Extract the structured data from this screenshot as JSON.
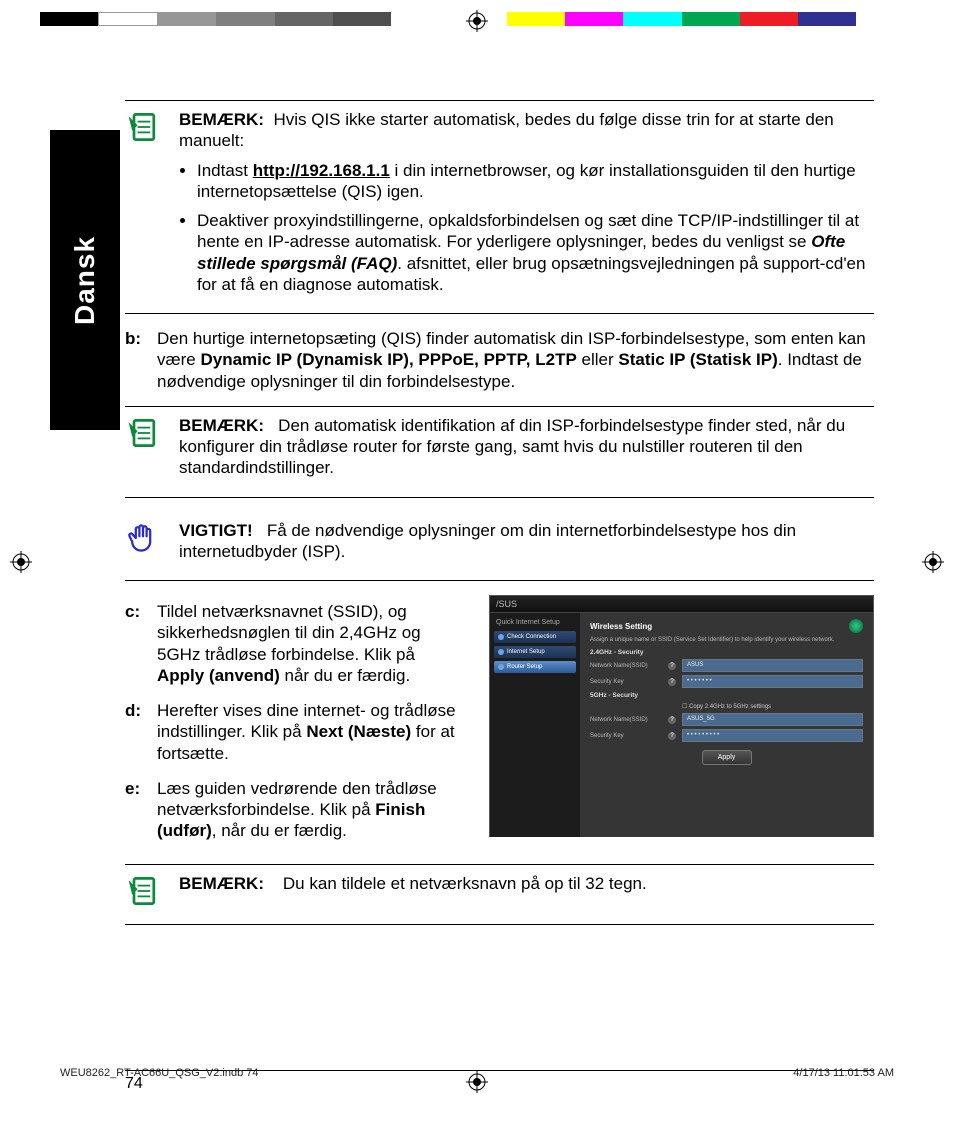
{
  "print": {
    "filename": "WEU8262_RT-AC66U_QSG_V2.indb   74",
    "timestamp": "4/17/13   11:01:53 AM"
  },
  "language_tab": "Dansk",
  "page_number": "74",
  "colorbar": [
    "#000000",
    "#ffffff",
    "#979797",
    "#7f7f7f",
    "#656565",
    "#4e4e4e",
    "#ffffff",
    "#ffffff",
    "#ffff00",
    "#ff00ff",
    "#00ffff",
    "#00a651",
    "#ee1c25",
    "#2e3192",
    "#ffffff"
  ],
  "note1": {
    "label": "BEMÆRK:",
    "intro": "Hvis QIS ikke starter automatisk, bedes du følge disse trin for at starte den manuelt:",
    "bullet1_pre": "Indtast ",
    "bullet1_url": "http://192.168.1.1",
    "bullet1_post": " i din internetbrowser, og kør installationsguiden til den hurtige internetopsættelse (QIS) igen.",
    "bullet2_pre": "Deaktiver proxyindstillingerne, opkaldsforbindelsen og sæt dine TCP/IP-indstillinger til at hente en IP-adresse automatisk. For yderligere oplysninger, bedes du venligst se ",
    "bullet2_bold": "Ofte stillede spørgsmål (FAQ)",
    "bullet2_post": ". afsnittet, eller brug opsætningsvejledningen på support-cd'en for at få en diagnose automatisk."
  },
  "step_b": {
    "label": "b:",
    "pre": "Den hurtige internetopsæting (QIS) finder automatisk din ISP-forbindelsestype, som enten kan være ",
    "bold1": "Dynamic IP (Dynamisk IP), PPPoE, PPTP, L2TP",
    "mid": " eller ",
    "bold2": "Static IP (Statisk IP)",
    "post": ". Indtast de nødvendige oplysninger til din forbindelsestype."
  },
  "note2": {
    "label": "BEMÆRK:",
    "text": "Den automatisk identifikation af din ISP-forbindelsestype finder sted, når du konfigurer din trådløse router for første gang, samt hvis du nulstiller routeren til den standardindstillinger."
  },
  "important": {
    "label": "VIGTIGT!",
    "text": "Få de nødvendige oplysninger om din internetforbindelsestype hos din internetudbyder (ISP)."
  },
  "step_c": {
    "label": "c:",
    "pre": "Tildel netværksnavnet (SSID), og sikkerhedsnøglen til din 2,4GHz og 5GHz trådløse forbindelse. Klik på ",
    "bold": "Apply (anvend)",
    "post": " når du er færdig."
  },
  "step_d": {
    "label": "d:",
    "pre": "Herefter vises dine internet- og trådløse indstillinger. Klik på ",
    "bold": "Next (Næste)",
    "post": " for at fortsætte."
  },
  "step_e": {
    "label": "e:",
    "pre": "Læs guiden vedrørende den trådløse netværksforbindelse. Klik på ",
    "bold": "Finish (udfør)",
    "post": ", når du er færdig."
  },
  "note3": {
    "label": "BEMÆRK:",
    "text": "Du kan tildele et netværksnavn på op til 32 tegn."
  },
  "router": {
    "brand": "/SUS",
    "side_header": "Quick Internet Setup",
    "side_items": [
      "Check Connection",
      "Internet Setup",
      "Router Setup"
    ],
    "panel_title": "Wireless Setting",
    "panel_sub": "Assign a unique name or SSID (Service Set Identifier) to help identify your wireless network.",
    "section1": "2.4GHz - Security",
    "section2": "5GHz - Security",
    "row1_label": "Network Name(SSID)",
    "row1_value": "ASUS",
    "row2_label": "Security Key",
    "row2_value": "• • • • • • •",
    "copy_checkbox": "Copy 2.4GHz to 5GHz settings",
    "row3_label": "Network Name(SSID)",
    "row3_value": "ASUS_5G",
    "row4_label": "Security Key",
    "row4_value": "• • • • • • • • •",
    "apply": "Apply"
  }
}
